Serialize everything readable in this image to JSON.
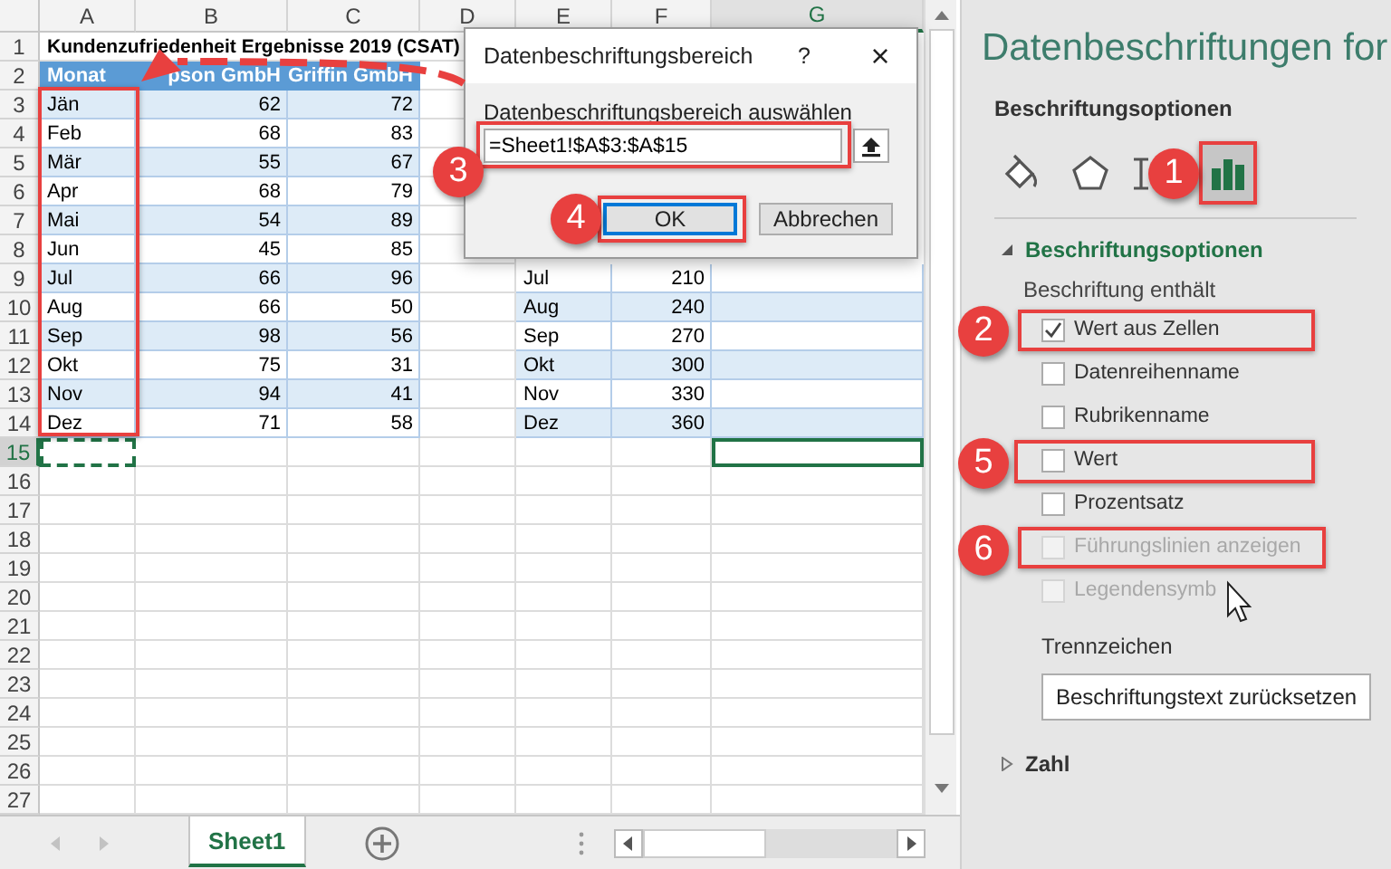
{
  "sheet": {
    "column_headers": [
      "A",
      "B",
      "C",
      "D",
      "E",
      "F",
      "G"
    ],
    "rows": [
      {
        "number": "1",
        "cells": [
          "Kundenzufriedenheit Ergebnisse 2019 (CSAT)",
          null,
          null,
          null,
          null,
          null,
          null
        ]
      },
      {
        "number": "2",
        "cells": [
          "Monat",
          "pson GmbH",
          "Griffin GmbH",
          null,
          null,
          null,
          null
        ]
      },
      {
        "number": "3",
        "cells": [
          "Jän",
          "62",
          "72",
          null,
          null,
          null,
          null
        ]
      },
      {
        "number": "4",
        "cells": [
          "Feb",
          "68",
          "83",
          null,
          null,
          null,
          null
        ]
      },
      {
        "number": "5",
        "cells": [
          "Mär",
          "55",
          "67",
          null,
          null,
          null,
          null
        ]
      },
      {
        "number": "6",
        "cells": [
          "Apr",
          "68",
          "79",
          null,
          null,
          null,
          null
        ]
      },
      {
        "number": "7",
        "cells": [
          "Mai",
          "54",
          "89",
          null,
          null,
          null,
          null
        ]
      },
      {
        "number": "8",
        "cells": [
          "Jun",
          "45",
          "85",
          null,
          null,
          null,
          null
        ]
      },
      {
        "number": "9",
        "cells": [
          "Jul",
          "66",
          "96",
          null,
          "Jul",
          "210",
          null
        ]
      },
      {
        "number": "10",
        "cells": [
          "Aug",
          "66",
          "50",
          null,
          "Aug",
          "240",
          null
        ]
      },
      {
        "number": "11",
        "cells": [
          "Sep",
          "98",
          "56",
          null,
          "Sep",
          "270",
          null
        ]
      },
      {
        "number": "12",
        "cells": [
          "Okt",
          "75",
          "31",
          null,
          "Okt",
          "300",
          null
        ]
      },
      {
        "number": "13",
        "cells": [
          "Nov",
          "94",
          "41",
          null,
          "Nov",
          "330",
          null
        ]
      },
      {
        "number": "14",
        "cells": [
          "Dez",
          "71",
          "58",
          null,
          "Dez",
          "360",
          null
        ]
      },
      {
        "number": "15"
      },
      {
        "number": "16"
      },
      {
        "number": "17"
      },
      {
        "number": "18"
      },
      {
        "number": "19"
      },
      {
        "number": "20"
      },
      {
        "number": "21"
      },
      {
        "number": "22"
      },
      {
        "number": "23"
      },
      {
        "number": "24"
      },
      {
        "number": "25"
      },
      {
        "number": "26"
      },
      {
        "number": "27"
      }
    ],
    "tabs": [
      {
        "label": "Sheet1",
        "selected": true
      }
    ]
  },
  "dialog": {
    "title": "Datenbeschriftungsbereich",
    "help": "?",
    "close": "×",
    "label": "Datenbeschriftungsbereich auswählen",
    "input": {
      "value": "=Sheet1!$A$3:$A$15"
    },
    "buttons": [
      {
        "label": "OK",
        "kind": "default"
      },
      {
        "label": "Abbrechen",
        "kind": "normal"
      }
    ]
  },
  "pane": {
    "title": "Datenbeschriftungen for",
    "section_label": "Beschriftungsoptionen",
    "icon_tabs": [
      {
        "kind": "fill",
        "selected": false
      },
      {
        "kind": "effects",
        "selected": false
      },
      {
        "kind": "size",
        "selected": false
      },
      {
        "kind": "chart",
        "selected": true
      }
    ],
    "groups": [
      {
        "title": "Beschriftungsoptionen",
        "expanded": true,
        "subtitle": "Beschriftung enthält",
        "options": [
          {
            "label": "Wert aus Zellen",
            "checked": true,
            "disabled": false
          },
          {
            "label": "Datenreihenname",
            "checked": false,
            "disabled": false
          },
          {
            "label": "Rubrikenname",
            "checked": false,
            "disabled": false
          },
          {
            "label": "Wert",
            "checked": false,
            "disabled": false
          },
          {
            "label": "Prozentsatz",
            "checked": false,
            "disabled": false
          },
          {
            "label": "Führungslinien anzeigen",
            "checked": false,
            "disabled": true
          },
          {
            "label": "Legendensymb",
            "checked": false,
            "disabled": true
          }
        ],
        "separator_label": "Trennzeichen",
        "reset_button": "Beschriftungstext zurücksetzen"
      },
      {
        "title": "Zahl",
        "expanded": false
      }
    ]
  },
  "annotations": {
    "badges": [
      "1",
      "2",
      "3",
      "4",
      "5",
      "6"
    ]
  }
}
